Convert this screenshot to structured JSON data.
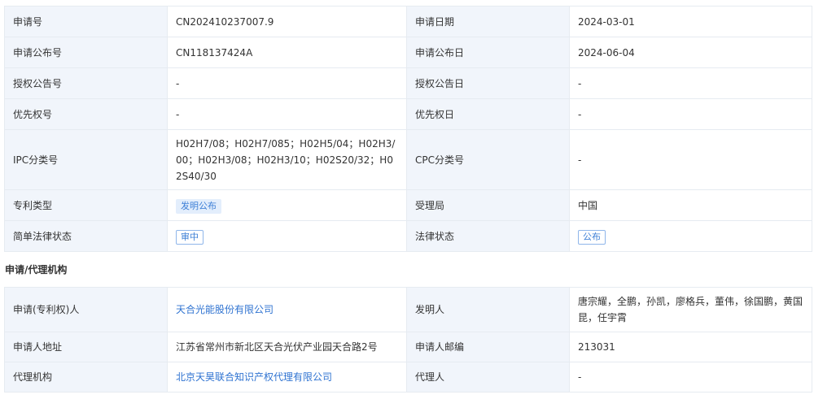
{
  "basic": [
    {
      "l1": "申请号",
      "v1": "CN202410237007.9",
      "l2": "申请日期",
      "v2": "2024-03-01"
    },
    {
      "l1": "申请公布号",
      "v1": "CN118137424A",
      "l2": "申请公布日",
      "v2": "2024-06-04"
    },
    {
      "l1": "授权公告号",
      "v1": "-",
      "l2": "授权公告日",
      "v2": "-"
    },
    {
      "l1": "优先权号",
      "v1": "-",
      "l2": "优先权日",
      "v2": "-"
    },
    {
      "l1": "IPC分类号",
      "v1": "H02H7/08；H02H7/085；H02H5/04；H02H3/00；H02H3/08；H02H3/10；H02S20/32；H02S40/30",
      "l2": "CPC分类号",
      "v2": "-"
    },
    {
      "l1": "专利类型",
      "v1": "发明公布",
      "l2": "受理局",
      "v2": "中国"
    },
    {
      "l1": "简单法律状态",
      "v1": "审中",
      "l2": "法律状态",
      "v2": "公布"
    }
  ],
  "agency": {
    "section_title": "申请/代理机构",
    "rows": [
      {
        "l1": "申请(专利权)人",
        "v1": "天合光能股份有限公司",
        "l2": "发明人",
        "v2": "唐宗耀，全鹏，孙凯，廖格兵，董伟，徐国鹏，黄国昆，任宇霄"
      },
      {
        "l1": "申请人地址",
        "v1": "江苏省常州市新北区天合光伏产业园天合路2号",
        "l2": "申请人邮编",
        "v2": "213031"
      },
      {
        "l1": "代理机构",
        "v1": "北京天昊联合知识产权代理有限公司",
        "l2": "代理人",
        "v2": "-"
      }
    ]
  },
  "colors": {
    "label_bg": "#f1f5fb",
    "border": "#e6ebf1",
    "link": "#2f73d1",
    "tag_text": "#3d7fd6",
    "tag_bg": "#e3eefc"
  }
}
